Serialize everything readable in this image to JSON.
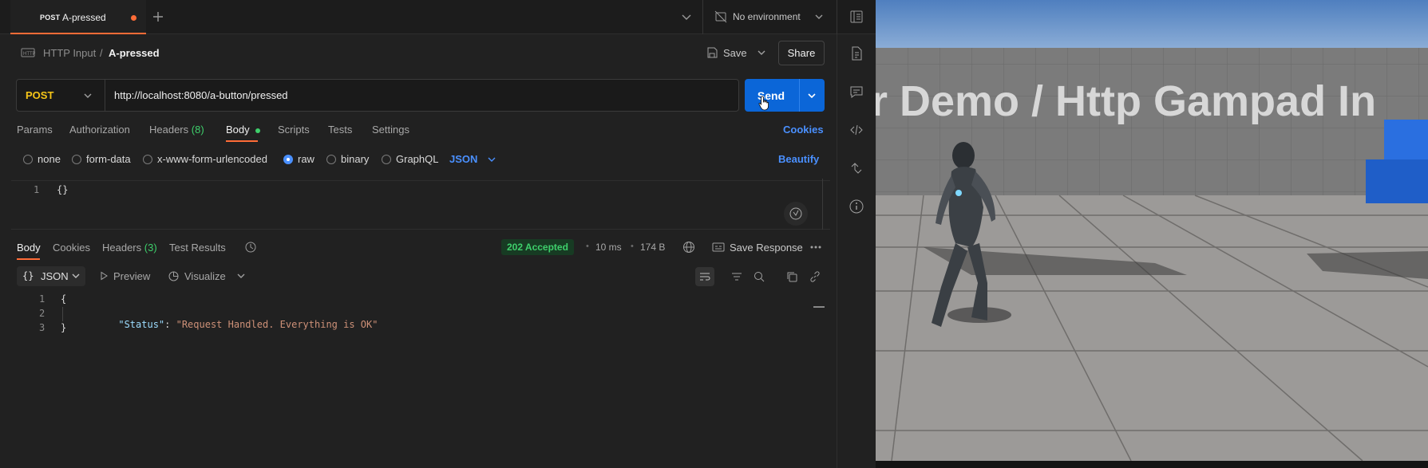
{
  "tab": {
    "method": "POST",
    "title": "A-pressed"
  },
  "environment": {
    "label": "No environment"
  },
  "breadcrumb": {
    "collection": "HTTP Input",
    "separator": "/",
    "request": "A-pressed"
  },
  "actions": {
    "save": "Save",
    "share": "Share"
  },
  "request": {
    "method": "POST",
    "url": "http://localhost:8080/a-button/pressed",
    "send": "Send"
  },
  "request_tabs": {
    "params": "Params",
    "authorization": "Authorization",
    "headers": "Headers",
    "headers_count": "(8)",
    "body": "Body",
    "scripts": "Scripts",
    "tests": "Tests",
    "settings": "Settings",
    "cookies": "Cookies"
  },
  "body_types": {
    "none": "none",
    "form_data": "form-data",
    "urlencoded": "x-www-form-urlencoded",
    "raw": "raw",
    "binary": "binary",
    "graphql": "GraphQL",
    "format": "JSON",
    "beautify": "Beautify"
  },
  "request_body": {
    "line_no": "1",
    "content": "{}"
  },
  "response_tabs": {
    "body": "Body",
    "cookies": "Cookies",
    "headers": "Headers",
    "headers_count": "(3)",
    "test_results": "Test Results"
  },
  "response_meta": {
    "status": "202 Accepted",
    "time": "10 ms",
    "size": "174 B",
    "save_response": "Save Response"
  },
  "response_toolbar": {
    "format": "JSON",
    "preview": "Preview",
    "visualize": "Visualize"
  },
  "response_body": {
    "lines": [
      "1",
      "2",
      "3"
    ],
    "open": "{",
    "key": "\"Status\"",
    "colon": ": ",
    "value": "\"Request Handled. Everything is OK\"",
    "close": "}"
  },
  "game": {
    "banner": "r Demo / Http Gampad In"
  },
  "colors": {
    "accent": "#ff6c37",
    "send": "#0b66d8",
    "link": "#4a90ff",
    "status_ok": "#3ecf6b",
    "method_post": "#f5c518",
    "json_key": "#9cdcfe",
    "json_string": "#ce9178"
  }
}
